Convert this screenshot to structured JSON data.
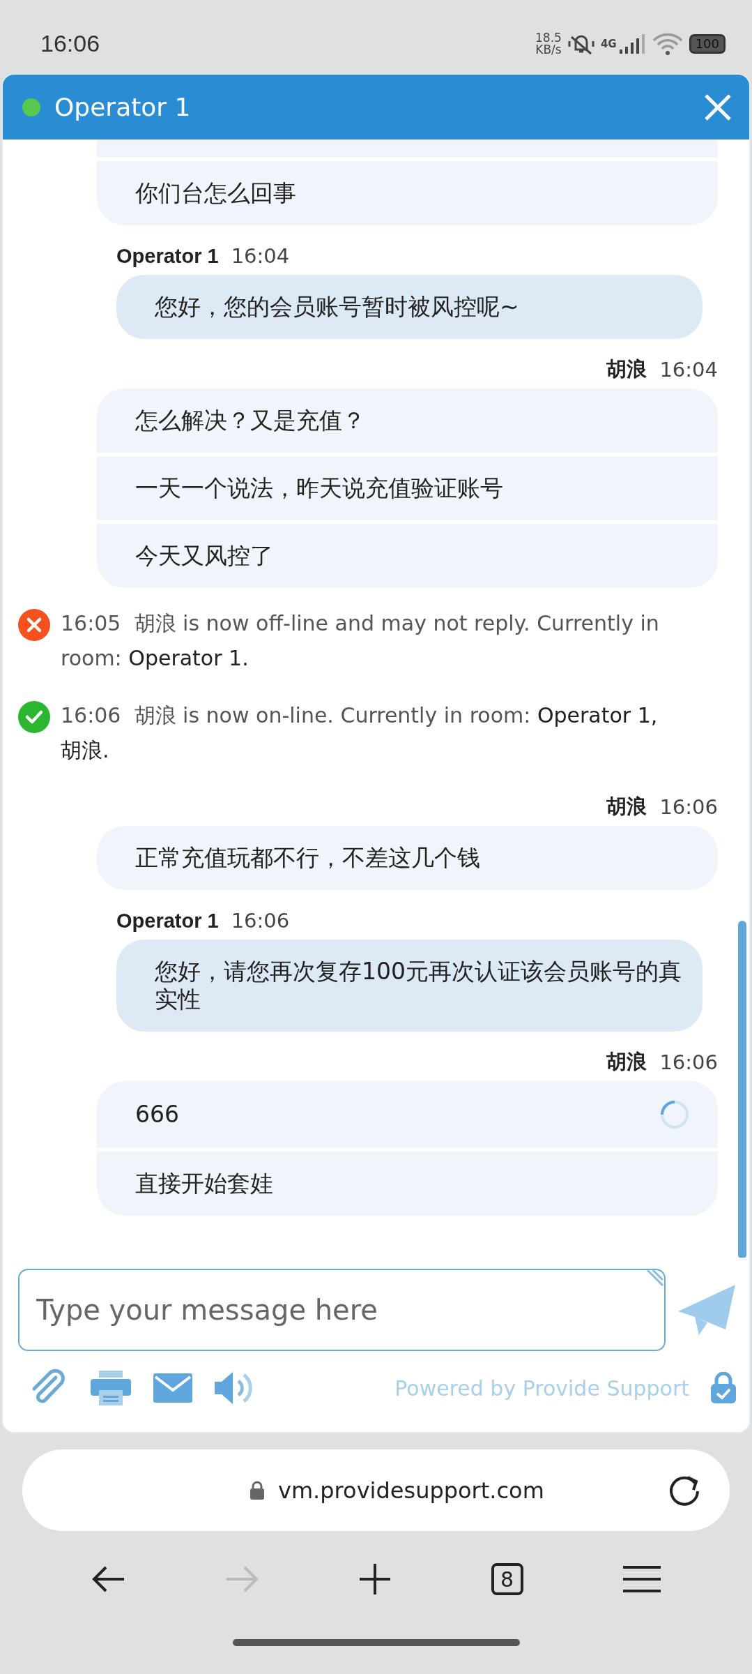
{
  "status_bar": {
    "time": "16:06",
    "net_speed": [
      "18.5",
      "KB/s"
    ],
    "network": "4G",
    "battery": "100"
  },
  "chat": {
    "title": "Operator 1",
    "online": true,
    "items": [
      {
        "kind": "visitor",
        "continued": true,
        "messages": [
          {
            "text": "你们台怎么回事",
            "sending": false
          }
        ]
      },
      {
        "kind": "operator",
        "sender": "Operator 1",
        "time": "16:04",
        "messages": [
          {
            "text": "您好，您的会员账号暂时被风控呢~"
          }
        ]
      },
      {
        "kind": "visitor",
        "sender": "胡浪",
        "time": "16:04",
        "messages": [
          {
            "text": "怎么解决？又是充值？",
            "sending": false
          },
          {
            "text": "一天一个说法，昨天说充值验证账号",
            "sending": false
          },
          {
            "text": "今天又风控了",
            "sending": false
          }
        ]
      },
      {
        "kind": "system",
        "online": false,
        "time": "16:05",
        "name": "胡浪",
        "text": "is now off-line and may not reply. Currently in room:",
        "room": "Operator 1."
      },
      {
        "kind": "system",
        "online": true,
        "time": "16:06",
        "name": "胡浪",
        "text": "is now on-line. Currently in room:",
        "room": "Operator 1, 胡浪."
      },
      {
        "kind": "visitor",
        "sender": "胡浪",
        "time": "16:06",
        "messages": [
          {
            "text": "正常充值玩都不行，不差这几个钱",
            "sending": false
          }
        ]
      },
      {
        "kind": "operator",
        "sender": "Operator 1",
        "time": "16:06",
        "messages": [
          {
            "text": "您好，请您再次复存100元再次认证该会员账号的真实性"
          }
        ]
      },
      {
        "kind": "visitor",
        "sender": "胡浪",
        "time": "16:06",
        "messages": [
          {
            "text": "666",
            "sending": true
          },
          {
            "text": "直接开始套娃",
            "sending": false
          }
        ]
      }
    ]
  },
  "composer": {
    "placeholder": "Type your message here",
    "powered_by": "Powered by Provide Support"
  },
  "browser": {
    "url": "vm.providesupport.com",
    "tab_count": "8",
    "forward_enabled": false
  }
}
